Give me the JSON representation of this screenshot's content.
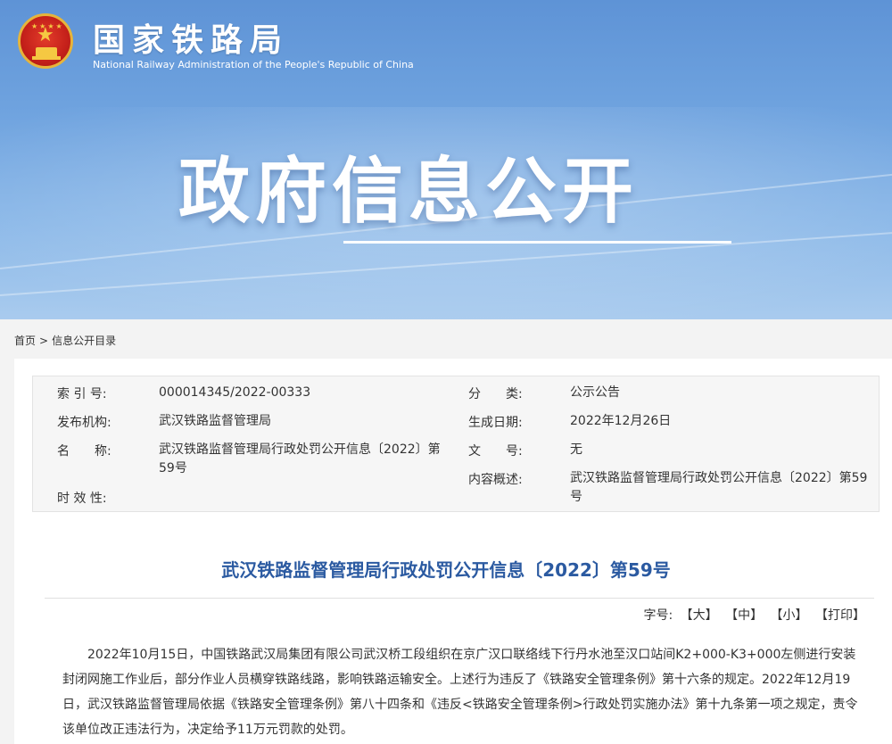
{
  "header": {
    "org_name": "国家铁路局",
    "org_name_en": "National Railway Administration of the People's Republic of China",
    "banner_title": "政府信息公开"
  },
  "breadcrumb": {
    "home": "首页",
    "separator": ">",
    "current": "信息公开目录"
  },
  "meta": {
    "index_label": "索 引 号:",
    "index_value": "000014345/2022-00333",
    "category_label": "分　　类:",
    "category_value": "公示公告",
    "publisher_label": "发布机构:",
    "publisher_value": "武汉铁路监督管理局",
    "date_label": "生成日期:",
    "date_value": "2022年12月26日",
    "name_label": "名　　称:",
    "name_value": "武汉铁路监督管理局行政处罚公开信息〔2022〕第59号",
    "docno_label": "文　　号:",
    "docno_value": "无",
    "summary_label": "内容概述:",
    "summary_value": "武汉铁路监督管理局行政处罚公开信息〔2022〕第59号",
    "validity_label": "时 效 性:"
  },
  "article": {
    "title": "武汉铁路监督管理局行政处罚公开信息〔2022〕第59号",
    "font_size_label": "字号:",
    "font_large": "【大】",
    "font_medium": "【中】",
    "font_small": "【小】",
    "print": "【打印】",
    "body": "2022年10月15日，中国铁路武汉局集团有限公司武汉桥工段组织在京广汉口联络线下行丹水池至汉口站间K2+000-K3+000左侧进行安装封闭网施工作业后，部分作业人员横穿铁路线路，影响铁路运输安全。上述行为违反了《铁路安全管理条例》第十六条的规定。2022年12月19日，武汉铁路监督管理局依据《铁路安全管理条例》第八十四条和《违反<铁路安全管理条例>行政处罚实施办法》第十九条第一项之规定，责令该单位改正违法行为，决定给予11万元罚款的处罚。"
  },
  "colors": {
    "title_blue": "#2b5aa1",
    "banner_blue": "#6fa3df",
    "emblem_red": "#c4201a",
    "emblem_gold": "#e6b43b"
  }
}
